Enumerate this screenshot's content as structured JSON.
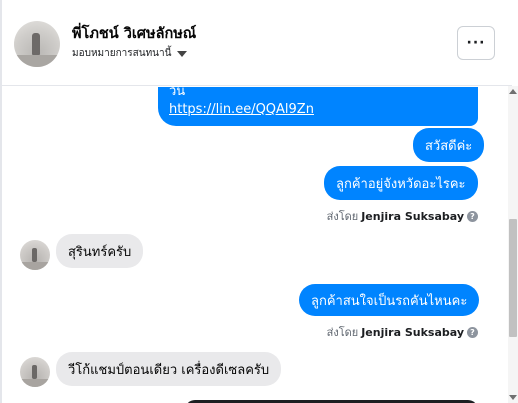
{
  "header": {
    "contact_name": "พี่โภชน์ วิเศษลักษณ์",
    "assign_label": "มอบหมายการสนทนานี้",
    "more_label": "···"
  },
  "messages": {
    "link_message": {
      "text_tail": "วัน",
      "url": "https://lin.ee/QQAl9Zn"
    },
    "out_1": "สวัสดีค่ะ",
    "out_2": "ลูกค้าอยู่จังหวัดอะไรคะ",
    "sent_by_1": {
      "prefix": "ส่งโดย",
      "name": "Jenjira Suksabay",
      "icon": "info-icon"
    },
    "in_1": "สุรินทร์ครับ",
    "out_3": "ลูกค้าสนใจเป็นรถคันไหนคะ",
    "sent_by_2": {
      "prefix": "ส่งโดย",
      "name": "Jenjira Suksabay",
      "icon": "info-icon"
    },
    "in_2": "วีโก้แชมป์ตอนเดียว เครื่องดีเซลครับ"
  },
  "colors": {
    "outgoing_bubble": "#0084ff",
    "incoming_bubble": "#e9e9eb",
    "header_border": "#e4e6eb"
  }
}
